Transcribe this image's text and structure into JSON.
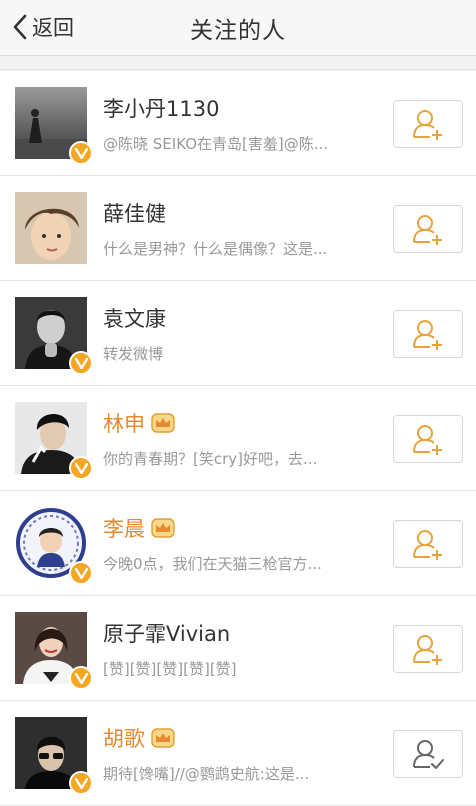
{
  "nav": {
    "back_label": "返回",
    "title": "关注的人"
  },
  "colors": {
    "accent": "#f5a623",
    "vip_name": "#e8892e",
    "follow_icon": "#e6a33a",
    "followed_icon": "#666666"
  },
  "users": [
    {
      "name": "李小丹1130",
      "desc": "@陈晓 SEIKO在青岛[害羞]@陈...",
      "verified": true,
      "vip": false,
      "button": "user-plus-icon"
    },
    {
      "name": "薛佳健",
      "desc": "什么是男神？什么是偶像？这是...",
      "verified": false,
      "vip": false,
      "button": "user-plus-icon"
    },
    {
      "name": "袁文康",
      "desc": "转发微博",
      "verified": true,
      "vip": false,
      "button": "user-plus-icon"
    },
    {
      "name": "林申",
      "desc": "你的青春期？[笑cry]好吧，去...",
      "verified": true,
      "vip": true,
      "button": "user-plus-icon"
    },
    {
      "name": "李晨",
      "desc": "今晚0点，我们在天猫三枪官方...",
      "verified": true,
      "vip": true,
      "button": "user-plus-icon"
    },
    {
      "name": "原子霏Vivian",
      "desc": "[赞][赞][赞][赞][赞]",
      "verified": true,
      "vip": false,
      "button": "user-plus-icon"
    },
    {
      "name": "胡歌",
      "desc": "期待[馋嘴]//@鹦鹉史航:这是...",
      "verified": true,
      "vip": true,
      "button": "user-check-icon"
    }
  ]
}
